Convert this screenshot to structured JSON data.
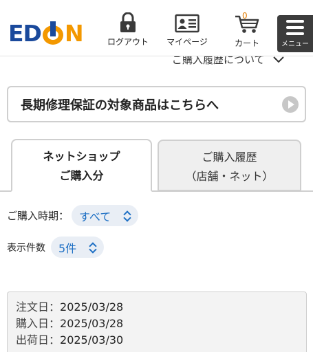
{
  "header": {
    "logo": {
      "ed": "ED",
      "n": "N"
    },
    "nav": [
      {
        "label": "ログアウト",
        "icon": "lock-icon"
      },
      {
        "label": "マイページ",
        "icon": "id-card-icon"
      },
      {
        "label": "カート",
        "icon": "cart-icon",
        "count": "0"
      }
    ],
    "menu_label": "メニュー"
  },
  "about_link": "ご購入履歴について",
  "warranty_button": "長期修理保証の対象商品はこちらへ",
  "tabs": [
    {
      "line1": "ネットショップ",
      "line2": "ご購入分",
      "active": true
    },
    {
      "line1": "ご購入履歴",
      "line2": "（店舗・ネット）",
      "active": false
    }
  ],
  "filters": {
    "period_label": "ご購入時期：",
    "period_value": "すべて",
    "count_label": "表示件数",
    "count_value": "5件"
  },
  "order": {
    "order_date_label": "注文日：",
    "order_date": "2025/03/28",
    "purchase_date_label": "購入日：",
    "purchase_date": "2025/03/28",
    "ship_date_label": "出荷日：",
    "ship_date": "2025/03/30"
  },
  "colors": {
    "brand_blue": "#1b4a9c",
    "brand_orange": "#f39800",
    "link_blue": "#1d6fc4"
  }
}
